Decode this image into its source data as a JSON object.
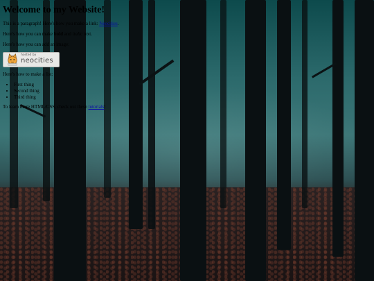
{
  "page": {
    "heading": "Welcome to my Website!",
    "intro_text": "This is a paragraph! Here's how you make a link:",
    "intro_link": "Neocities",
    "intro_end": ".",
    "format_before": "Here's how you can make",
    "format_bold": "bold",
    "format_and": "and",
    "format_italic": "italic",
    "format_end": "text.",
    "image_text": "Here's how you can add an image:",
    "badge_small": "hosted by",
    "badge_big": "neocities",
    "list_intro": "Here's how to make a list:",
    "list_items": [
      "First thing",
      "Second thing",
      "Third thing"
    ],
    "learn_text": "To learn more HTML/CSS, check out these",
    "learn_link": "tutorials",
    "learn_end": "!"
  },
  "colors": {
    "link": "#0a0aa8",
    "forest_sky": "#3c7677",
    "forest_floor": "#2a2424"
  },
  "icons": {
    "badge_mascot": "cat-icon"
  }
}
